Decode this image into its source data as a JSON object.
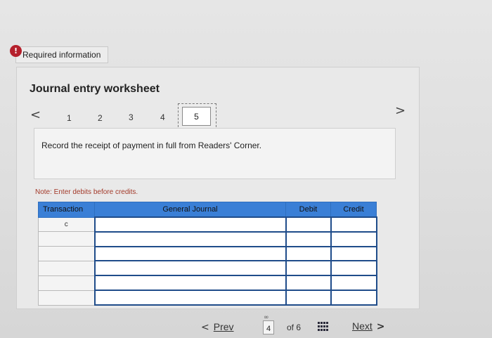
{
  "alert": {
    "badge": "!",
    "title": "Required information"
  },
  "worksheet": {
    "title": "Journal entry worksheet",
    "steps": [
      "1",
      "2",
      "3",
      "4",
      "5"
    ],
    "active_step": "5",
    "nav_prev": "<",
    "nav_next": ">"
  },
  "instruction": "Record the receipt of payment in full from Readers' Corner.",
  "note": "Note: Enter debits before credits.",
  "table": {
    "headers": {
      "transaction": "Transaction",
      "general_journal": "General Journal",
      "debit": "Debit",
      "credit": "Credit"
    },
    "rows": [
      {
        "transaction": "c",
        "account": "",
        "debit": "",
        "credit": ""
      },
      {
        "transaction": "",
        "account": "",
        "debit": "",
        "credit": ""
      },
      {
        "transaction": "",
        "account": "",
        "debit": "",
        "credit": ""
      },
      {
        "transaction": "",
        "account": "",
        "debit": "",
        "credit": ""
      },
      {
        "transaction": "",
        "account": "",
        "debit": "",
        "credit": ""
      },
      {
        "transaction": "",
        "account": "",
        "debit": "",
        "credit": ""
      }
    ]
  },
  "footer": {
    "prev_arrow": "<",
    "prev_label": "Prev",
    "link_icon": "link-icon",
    "current_page": "4",
    "of_text": "of 6",
    "grid_icon": "grid-icon",
    "next_label": "Next",
    "next_arrow": ">"
  }
}
